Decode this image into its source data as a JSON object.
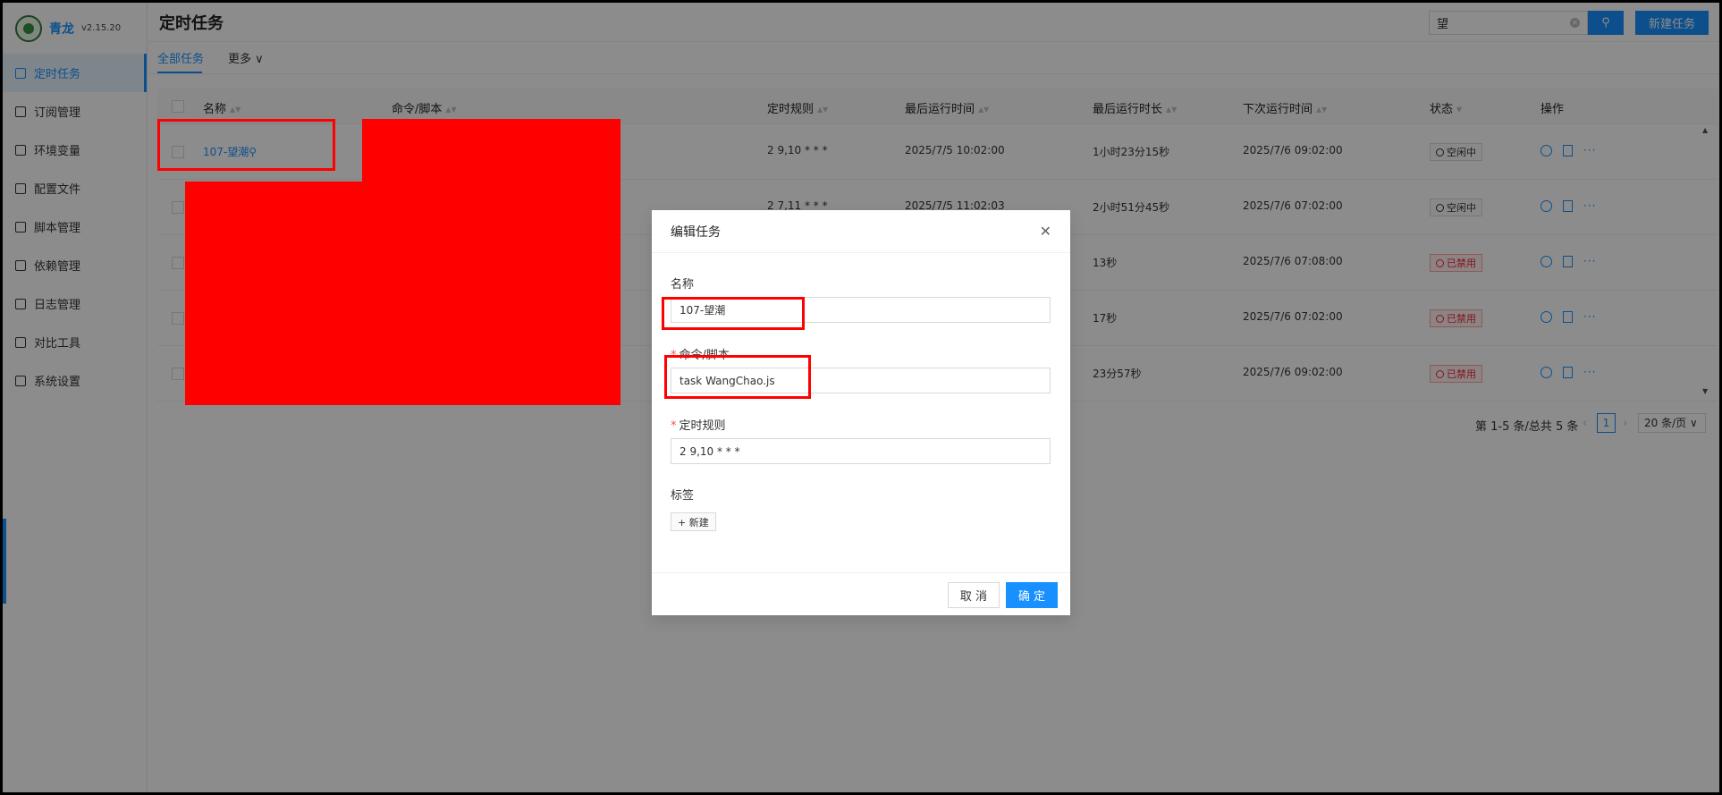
{
  "app": {
    "name": "青龙",
    "version": "v2.15.20"
  },
  "sidebar": {
    "items": [
      {
        "label": "定时任务",
        "icon": "calendar-icon",
        "active": true
      },
      {
        "label": "订阅管理",
        "icon": "subscription-icon"
      },
      {
        "label": "环境变量",
        "icon": "env-icon"
      },
      {
        "label": "配置文件",
        "icon": "config-icon"
      },
      {
        "label": "脚本管理",
        "icon": "script-icon"
      },
      {
        "label": "依赖管理",
        "icon": "dependency-icon"
      },
      {
        "label": "日志管理",
        "icon": "log-icon"
      },
      {
        "label": "对比工具",
        "icon": "diff-icon"
      },
      {
        "label": "系统设置",
        "icon": "gear-icon"
      }
    ]
  },
  "header": {
    "title": "定时任务",
    "search_value": "望",
    "search_icon": "search-icon",
    "new_task_label": "新建任务"
  },
  "tabs": {
    "all": "全部任务",
    "more": "更多"
  },
  "table": {
    "columns": [
      "名称",
      "命令/脚本",
      "定时规则",
      "最后运行时间",
      "最后运行时长",
      "下次运行时间",
      "状态",
      "操作"
    ],
    "rows": [
      {
        "name": "107-望潮",
        "schedule": "2 9,10 * * *",
        "last_run": "2025/7/5 10:02:00",
        "duration": "1小时23分15秒",
        "next_run": "2025/7/6 09:02:00",
        "status": "空闲中"
      },
      {
        "name": "",
        "schedule": "2 7,11 * * *",
        "last_run": "2025/7/5 11:02:03",
        "duration": "2小时51分45秒",
        "next_run": "2025/7/6 07:02:00",
        "status": "空闲中"
      },
      {
        "name": "",
        "schedule": "",
        "last_run": "",
        "duration": "13秒",
        "next_run": "2025/7/6 07:08:00",
        "status": "已禁用"
      },
      {
        "name": "",
        "schedule": "",
        "last_run": "",
        "duration": "17秒",
        "next_run": "2025/7/6 07:02:00",
        "status": "已禁用"
      },
      {
        "name": "",
        "schedule": "",
        "last_run": "",
        "duration": "23分57秒",
        "next_run": "2025/7/6 09:02:00",
        "status": "已禁用"
      }
    ]
  },
  "pagination": {
    "summary": "第 1-5 条/总共 5 条",
    "current_page": "1",
    "page_size": "20 条/页"
  },
  "modal": {
    "title": "编辑任务",
    "name_label": "名称",
    "name_value": "107-望潮",
    "command_label": "命令/脚本",
    "command_value": "task WangChao.js",
    "schedule_label": "定时规则",
    "schedule_value": "2 9,10 * * *",
    "tags_label": "标签",
    "add_tag_label": "+ 新建",
    "cancel_label": "取 消",
    "ok_label": "确 定"
  },
  "colors": {
    "primary": "#1890ff",
    "highlight": "#ff0000",
    "disabled": "#f5222d"
  }
}
